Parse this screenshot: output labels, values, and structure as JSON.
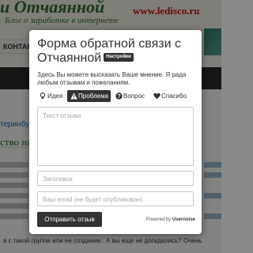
{
  "background_page": {
    "site_title": "и Отчаянной",
    "site_subtitle": "Блог о заработке в интернете",
    "site_url": "www.ledisco.ru",
    "nav_label": "КОНТАКТЫ",
    "link_text": "теринбург",
    "article_heading": "ство на",
    "bottom_text": "в с такой группе или ее создание . А вы еще не догадались? Очень"
  },
  "modal": {
    "title": "Форма обратной связи с Отчаянной",
    "settings_badge": "Настройки",
    "description": "Здесь Вы можете высказать Ваше мнение. Я рада любым отзывам и пожеланиям.",
    "tabs": [
      {
        "label": "Идея",
        "icon": "lightbulb-icon",
        "active": false
      },
      {
        "label": "Проблема",
        "icon": "warning-icon",
        "active": true
      },
      {
        "label": "Вопрос",
        "icon": "question-icon",
        "active": false
      },
      {
        "label": "Спасибо",
        "icon": "heart-icon",
        "active": false
      }
    ],
    "feedback_placeholder": "Текст отзыва",
    "subject_placeholder": "Заголовок",
    "email_placeholder": "Ваш email (не будет опубликован)",
    "submit_label": "Отправить отзыв",
    "powered_by_prefix": "Powered by",
    "powered_by_brand": "Usernoise"
  },
  "colors": {
    "modal_dark": "#333333",
    "site_title_green": "#2f6e2f",
    "site_url_red": "#cc1111"
  }
}
